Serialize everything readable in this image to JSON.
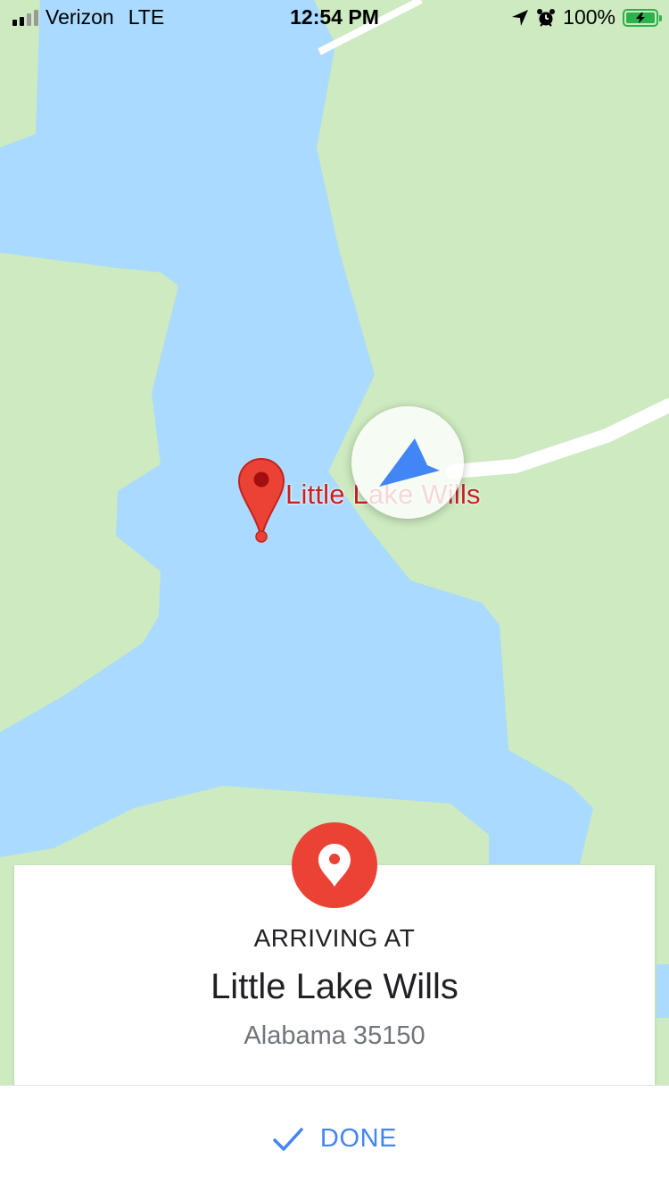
{
  "status_bar": {
    "carrier": "Verizon",
    "network": "LTE",
    "time": "12:54 PM",
    "battery_percent": "100%",
    "signal_bars_filled": 2,
    "signal_bars_total": 4
  },
  "map": {
    "place_label": "Little Lake Wills",
    "colors": {
      "land": "#cdeac0",
      "water": "#aadaff",
      "road": "#ffffff",
      "pin": "#ea4335",
      "nav_arrow": "#4285f4"
    }
  },
  "arrival_card": {
    "heading": "ARRIVING AT",
    "destination_name": "Little Lake Wills",
    "destination_address": "Alabama 35150",
    "icon": "place-pin-icon"
  },
  "done_button": {
    "label": "DONE",
    "icon": "checkmark-icon",
    "color": "#4285f4"
  }
}
